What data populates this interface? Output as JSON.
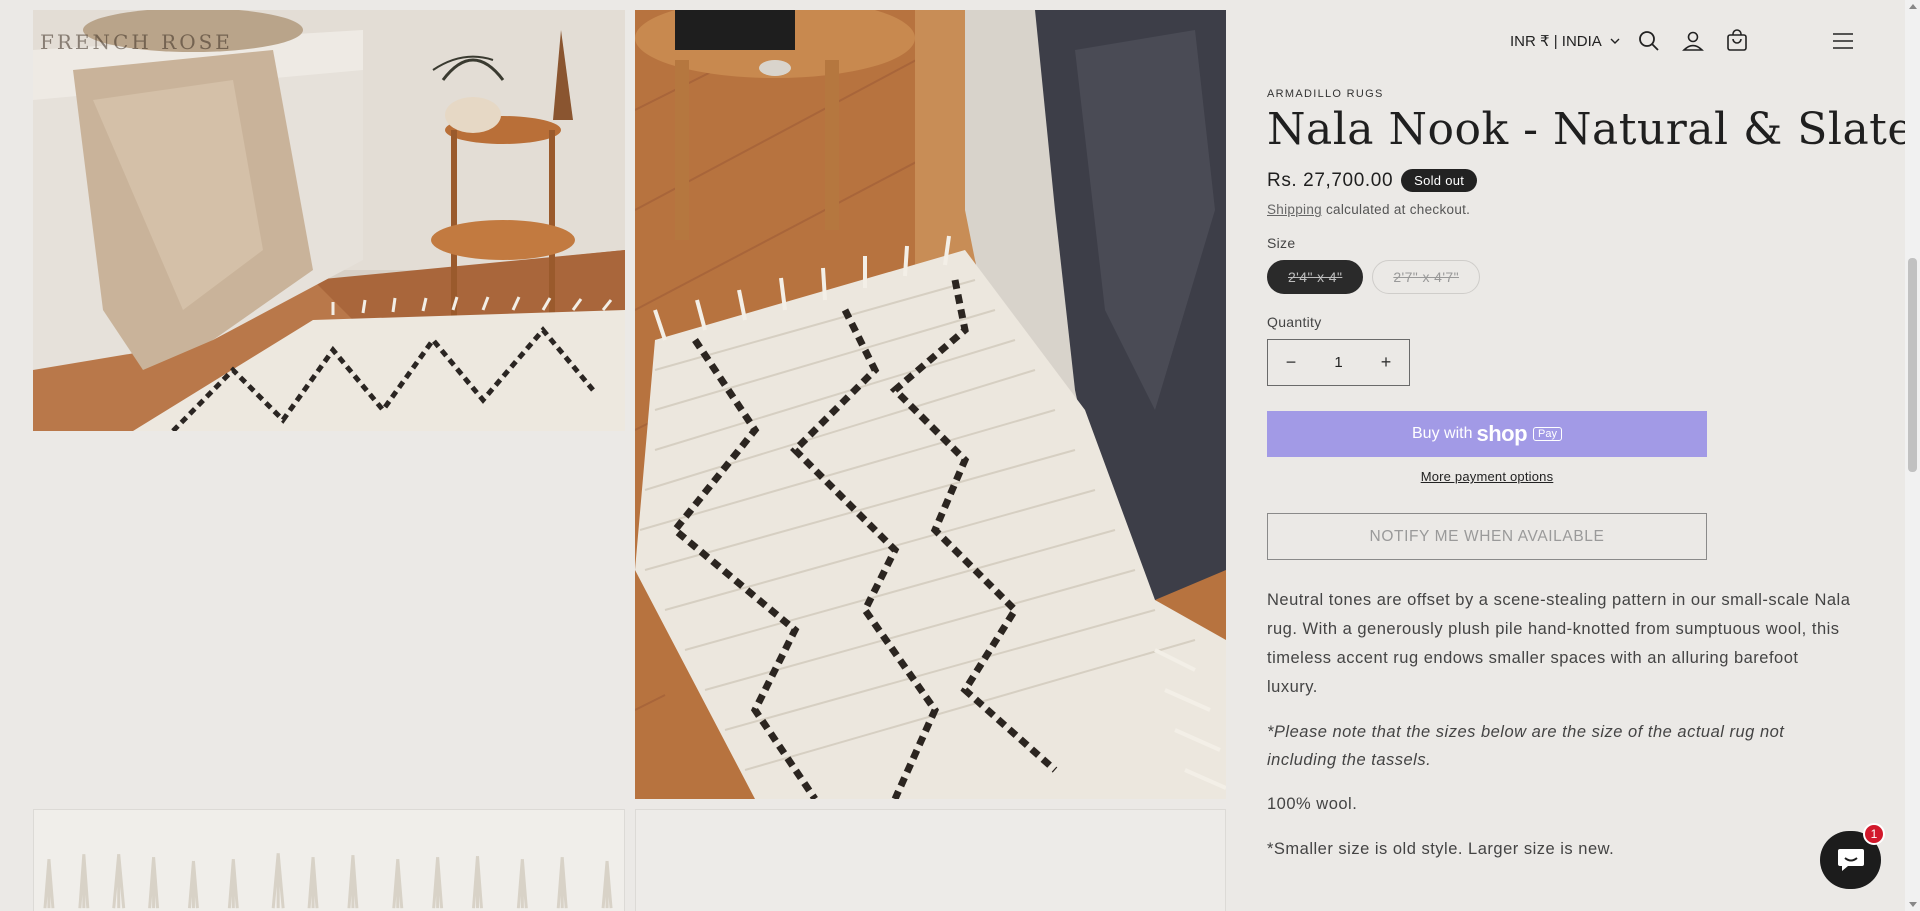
{
  "header": {
    "logo_text": "FRENCH ROSE",
    "currency_label": "INR ₹ | INDIA",
    "icons": [
      "search-icon",
      "account-icon",
      "cart-icon",
      "menu-icon",
      "chevron-down-icon"
    ]
  },
  "product": {
    "vendor": "ARMADILLO RUGS",
    "title": "Nala Nook - Natural & Slate",
    "price": "Rs. 27,700.00",
    "badge": "Sold out",
    "shipping_link": "Shipping",
    "shipping_rest": " calculated at checkout.",
    "size_label": "Size",
    "sizes": [
      "2'4\" x 4\"",
      "2'7\" x 4'7\""
    ],
    "selected_size_index": 0,
    "quantity_label": "Quantity",
    "quantity_value": "1",
    "qty_minus": "−",
    "qty_plus": "+",
    "buy_with": "Buy with",
    "shop_word": "shop",
    "pay_word": "Pay",
    "more_payment": "More payment options",
    "notify": "NOTIFY ME WHEN AVAILABLE",
    "description": [
      "Neutral tones are offset by a scene-stealing pattern in our small-scale Nala rug. With a generously plush pile hand-knotted from sumptuous wool, this timeless accent rug endows smaller spaces with an alluring barefoot luxury.",
      "*Please note that the sizes below are the size of the actual rug not including the tassels.",
      "100% wool.",
      "*Smaller size is old style. Larger size is new."
    ]
  },
  "chat": {
    "badge_count": "1",
    "icon": "chat-icon"
  },
  "colors": {
    "background": "#ebe9e6",
    "shop_pay": "#a29ae6",
    "badge": "#222222",
    "chat_badge": "#d2182b"
  }
}
